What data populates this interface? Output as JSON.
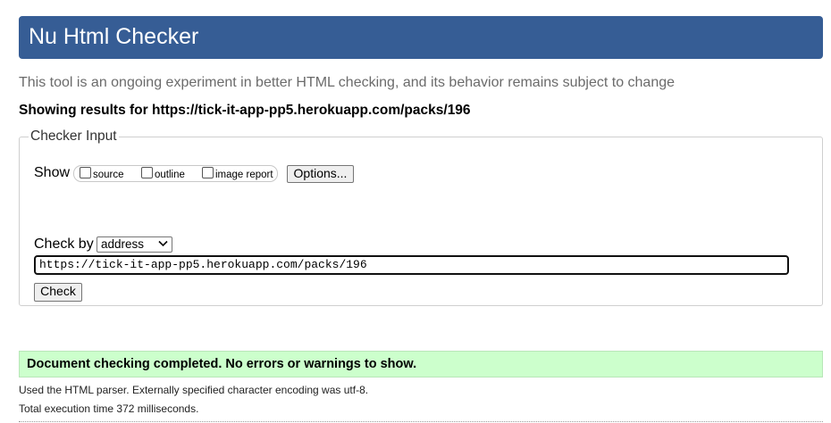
{
  "header": {
    "title": "Nu Html Checker"
  },
  "intro": "This tool is an ongoing experiment in better HTML checking, and its behavior remains subject to change",
  "showing": "Showing results for https://tick-it-app-pp5.herokuapp.com/packs/196",
  "checker": {
    "legend": "Checker Input",
    "show_label": "Show",
    "options": [
      {
        "label": "source",
        "checked": false
      },
      {
        "label": "outline",
        "checked": false
      },
      {
        "label": "image report",
        "checked": false
      }
    ],
    "options_button": "Options...",
    "check_by_label": "Check by",
    "check_by_value": "address",
    "url_value": "https://tick-it-app-pp5.herokuapp.com/packs/196",
    "check_button": "Check"
  },
  "result": {
    "message": "Document checking completed. No errors or warnings to show."
  },
  "info": {
    "parser": "Used the HTML parser. Externally specified character encoding was utf-8.",
    "execution": "Total execution time 372 milliseconds."
  },
  "colors": {
    "header_bg": "#365d95",
    "success_bg": "#ccffcc"
  }
}
